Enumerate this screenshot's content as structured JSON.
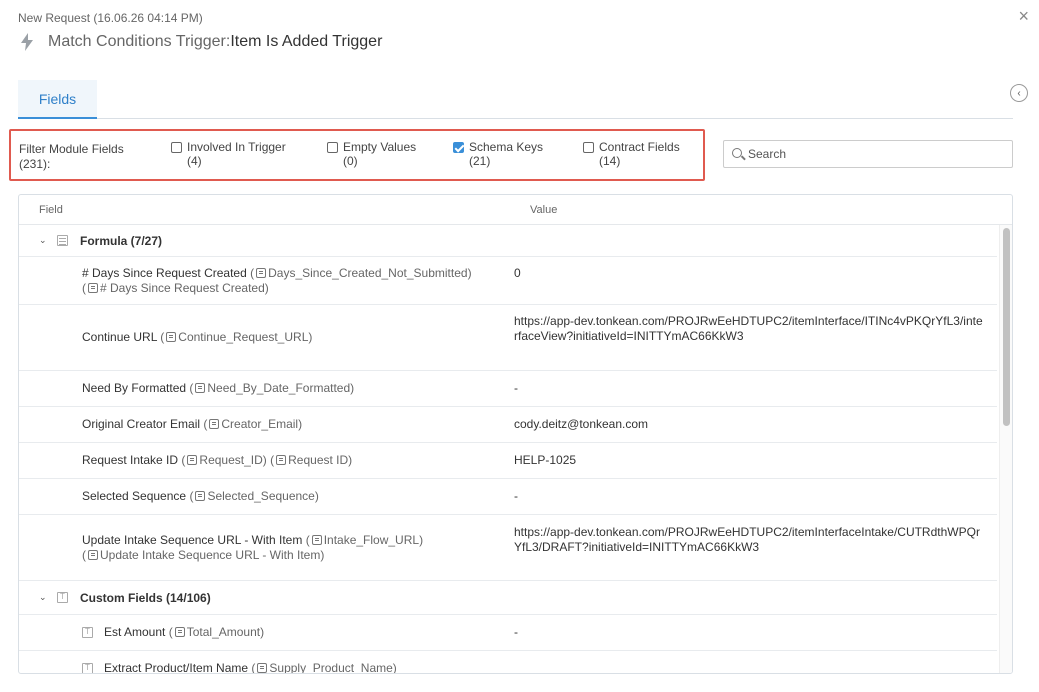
{
  "header": {
    "request_title": "New Request (16.06.26 04:14 PM)",
    "trigger_prefix": "Match Conditions Trigger: ",
    "trigger_name": "Item Is Added Trigger",
    "close_label": "×"
  },
  "tabs": [
    {
      "label": "Fields",
      "active": true
    }
  ],
  "filter": {
    "label": "Filter Module Fields (231):",
    "options": [
      {
        "label": "Involved In Trigger",
        "count": "(4)",
        "checked": false
      },
      {
        "label": "Empty Values",
        "count": "(0)",
        "checked": false
      },
      {
        "label": "Schema Keys",
        "count": "(21)",
        "checked": true
      },
      {
        "label": "Contract Fields",
        "count": "(14)",
        "checked": false
      }
    ]
  },
  "search": {
    "placeholder": "Search",
    "value": ""
  },
  "table": {
    "columns": [
      "Field",
      "Value"
    ],
    "groups": [
      {
        "label": "Formula (7/27)",
        "rows": [
          {
            "name": "# Days Since Request Created",
            "key": "Days_Since_Created_Not_Submitted",
            "alias": "# Days Since Request Created",
            "value": "0"
          },
          {
            "name": "Continue URL",
            "key": "Continue_Request_URL",
            "value": "https://app-dev.tonkean.com/PROJRwEeHDTUPC2/itemInterface/ITINc4vPKQrYfL3/interfaceView?initiativeId=INITTYmAC66KkW3"
          },
          {
            "name": "Need By Formatted",
            "key": "Need_By_Date_Formatted",
            "value": "-"
          },
          {
            "name": "Original Creator Email",
            "key": "Creator_Email",
            "value": "cody.deitz@tonkean.com"
          },
          {
            "name": "Request Intake ID",
            "key": "Request_ID",
            "alias": "Request ID",
            "value": "HELP-1025"
          },
          {
            "name": "Selected Sequence",
            "key": "Selected_Sequence",
            "value": "-"
          },
          {
            "name": "Update Intake Sequence URL - With Item",
            "key": "Intake_Flow_URL",
            "alias": "Update Intake Sequence URL - With Item",
            "value": "https://app-dev.tonkean.com/PROJRwEeHDTUPC2/itemInterfaceIntake/CUTRdthWPQrYfL3/DRAFT?initiativeId=INITTYmAC66KkW3"
          }
        ]
      },
      {
        "label": "Custom Fields (14/106)",
        "rows": [
          {
            "name": "Est Amount",
            "key": "Total_Amount",
            "value": "-"
          },
          {
            "name": "Extract Product/Item Name",
            "key": "Supply_Product_Name",
            "value": ""
          }
        ]
      }
    ]
  }
}
